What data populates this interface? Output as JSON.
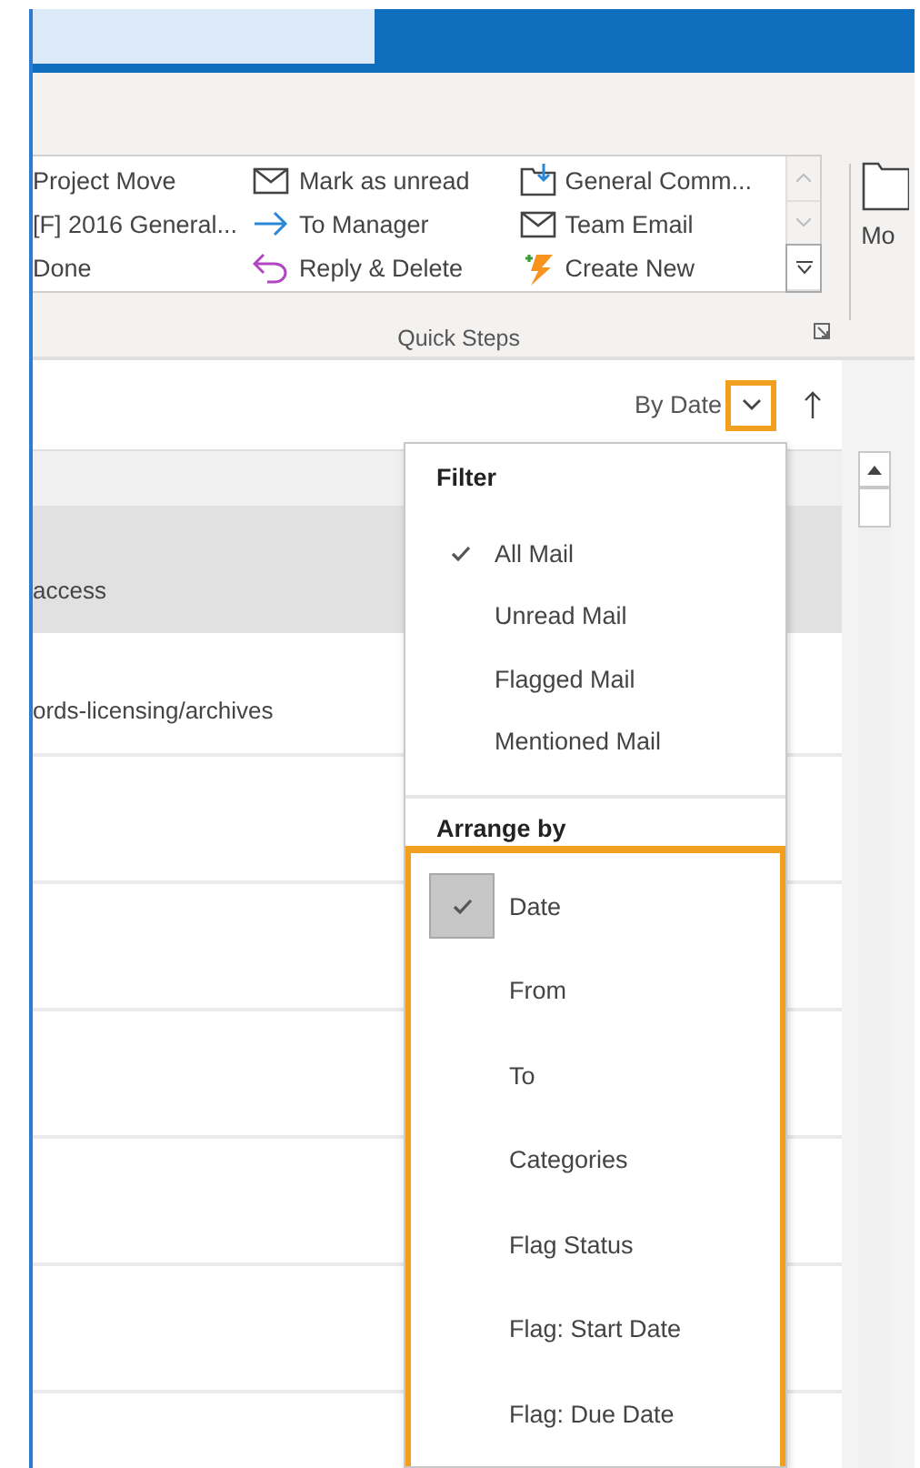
{
  "ribbon": {
    "quick_steps": {
      "label": "Quick Steps",
      "columns": [
        [
          "Project Move",
          "[F] 2016 General...",
          "Done"
        ],
        [
          "Mark as unread",
          "To Manager",
          "Reply & Delete"
        ],
        [
          "General Comm...",
          "Team Email",
          "Create New"
        ]
      ]
    },
    "next_group_label": "Mo"
  },
  "message_list": {
    "arrange_label": "By Date",
    "arrange_button_highlighted": true,
    "rows": [
      {
        "text": "access",
        "selected": true
      },
      {
        "text": "ords-licensing/archives",
        "selected": false
      }
    ]
  },
  "arrange_menu": {
    "sections": [
      {
        "kind": "filter",
        "title": "Filter",
        "highlighted": false,
        "items": [
          {
            "label": "All Mail",
            "selected": true
          },
          {
            "label": "Unread Mail",
            "selected": false
          },
          {
            "label": "Flagged Mail",
            "selected": false
          },
          {
            "label": "Mentioned Mail",
            "selected": false
          }
        ]
      },
      {
        "kind": "arrange",
        "title": "Arrange by",
        "highlighted": true,
        "items": [
          {
            "label": "Date",
            "selected": true
          },
          {
            "label": "From",
            "selected": false
          },
          {
            "label": "To",
            "selected": false
          },
          {
            "label": "Categories",
            "selected": false
          },
          {
            "label": "Flag Status",
            "selected": false
          },
          {
            "label": "Flag: Start Date",
            "selected": false
          },
          {
            "label": "Flag: Due Date",
            "selected": false
          }
        ]
      }
    ]
  }
}
